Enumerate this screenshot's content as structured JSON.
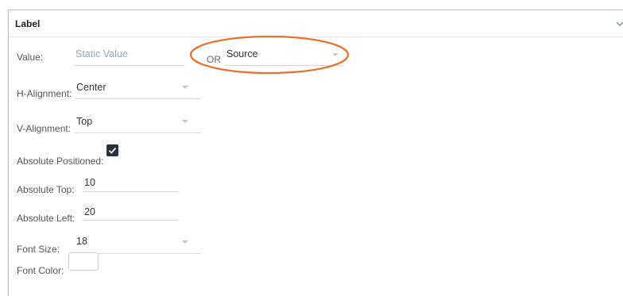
{
  "section": {
    "title": "Label"
  },
  "value_row": {
    "label": "Value:",
    "static_placeholder": "Static Value",
    "or_text": "OR",
    "source_value": "Source"
  },
  "h_alignment": {
    "label": "H-Alignment:",
    "value": "Center"
  },
  "v_alignment": {
    "label": "V-Alignment:",
    "value": "Top"
  },
  "absolute_positioned": {
    "label": "Absolute Positioned:",
    "checked": true
  },
  "absolute_top": {
    "label": "Absolute Top:",
    "value": "10"
  },
  "absolute_left": {
    "label": "Absolute Left:",
    "value": "20"
  },
  "font_size": {
    "label": "Font Size:",
    "value": "18"
  },
  "font_color": {
    "label": "Font Color:"
  },
  "colors": {
    "highlight": "#e8702a",
    "checkbox": "#263238",
    "placeholder": "#8fa6bf"
  },
  "icons": {
    "collapse": "chevron-down-icon",
    "check": "checkmark-icon"
  }
}
